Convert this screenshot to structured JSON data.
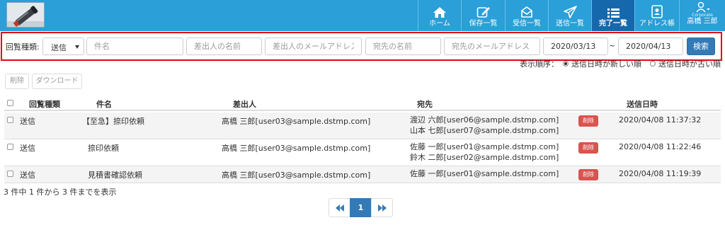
{
  "nav": {
    "items": [
      {
        "label": "ホーム",
        "icon": "home-icon"
      },
      {
        "label": "保存一覧",
        "icon": "edit-icon"
      },
      {
        "label": "受信一覧",
        "icon": "inbox-icon"
      },
      {
        "label": "送信一覧",
        "icon": "send-icon"
      },
      {
        "label": "完了一覧",
        "icon": "list-icon"
      },
      {
        "label": "アドレス帳",
        "icon": "address-book-icon"
      }
    ],
    "user": {
      "corp": "Corporate",
      "name": "高橋 三郎",
      "icon": "user-icon"
    }
  },
  "search": {
    "type_label": "回覧種類:",
    "type_value": "送信",
    "subject_placeholder": "件名",
    "sender_name_placeholder": "差出人の名前",
    "sender_email_placeholder": "差出人のメールアドレス",
    "to_name_placeholder": "宛先の名前",
    "to_email_placeholder": "宛先のメールアドレス",
    "date_from": "2020/03/13",
    "tilde": "~",
    "date_to": "2020/04/13",
    "button": "検索"
  },
  "sort": {
    "label": "表示順序：",
    "option_newest": "送信日時が新しい順",
    "option_oldest": "送信日時が古い順"
  },
  "actions": {
    "delete": "削除",
    "download": "ダウンロード"
  },
  "table": {
    "headers": {
      "type": "回覧種類",
      "subject": "件名",
      "sender": "差出人",
      "recipients": "宛先",
      "sent_at": "送信日時"
    },
    "rows": [
      {
        "type": "送信",
        "subject": "【至急】捺印依頼",
        "sender": "高橋 三郎[user03@sample.dstmp.com]",
        "recipients": [
          "渡辺 六郎[user06@sample.dstmp.com]",
          "山本 七郎[user07@sample.dstmp.com]"
        ],
        "delete": "削除",
        "sent_at": "2020/04/08 11:37:32"
      },
      {
        "type": "送信",
        "subject": "捺印依頼",
        "sender": "高橋 三郎[user03@sample.dstmp.com]",
        "recipients": [
          "佐藤 一郎[user01@sample.dstmp.com]",
          "鈴木 二郎[user02@sample.dstmp.com]"
        ],
        "delete": "削除",
        "sent_at": "2020/04/08 11:22:46"
      },
      {
        "type": "送信",
        "subject": "見積書確認依頼",
        "sender": "高橋 三郎[user03@sample.dstmp.com]",
        "recipients": [
          "佐藤 一郎[user01@sample.dstmp.com]"
        ],
        "delete": "削除",
        "sent_at": "2020/04/08 11:19:39"
      }
    ]
  },
  "footer": {
    "count_text": "3 件中 1 件から 3 件までを表示"
  },
  "pagination": {
    "prev": "«",
    "current": "1",
    "next": "»"
  },
  "colors": {
    "navbar": "#2a9fd8",
    "nav_active": "#1668ad",
    "highlight_border": "#e30613",
    "primary": "#337ab7",
    "danger": "#d9534f"
  }
}
